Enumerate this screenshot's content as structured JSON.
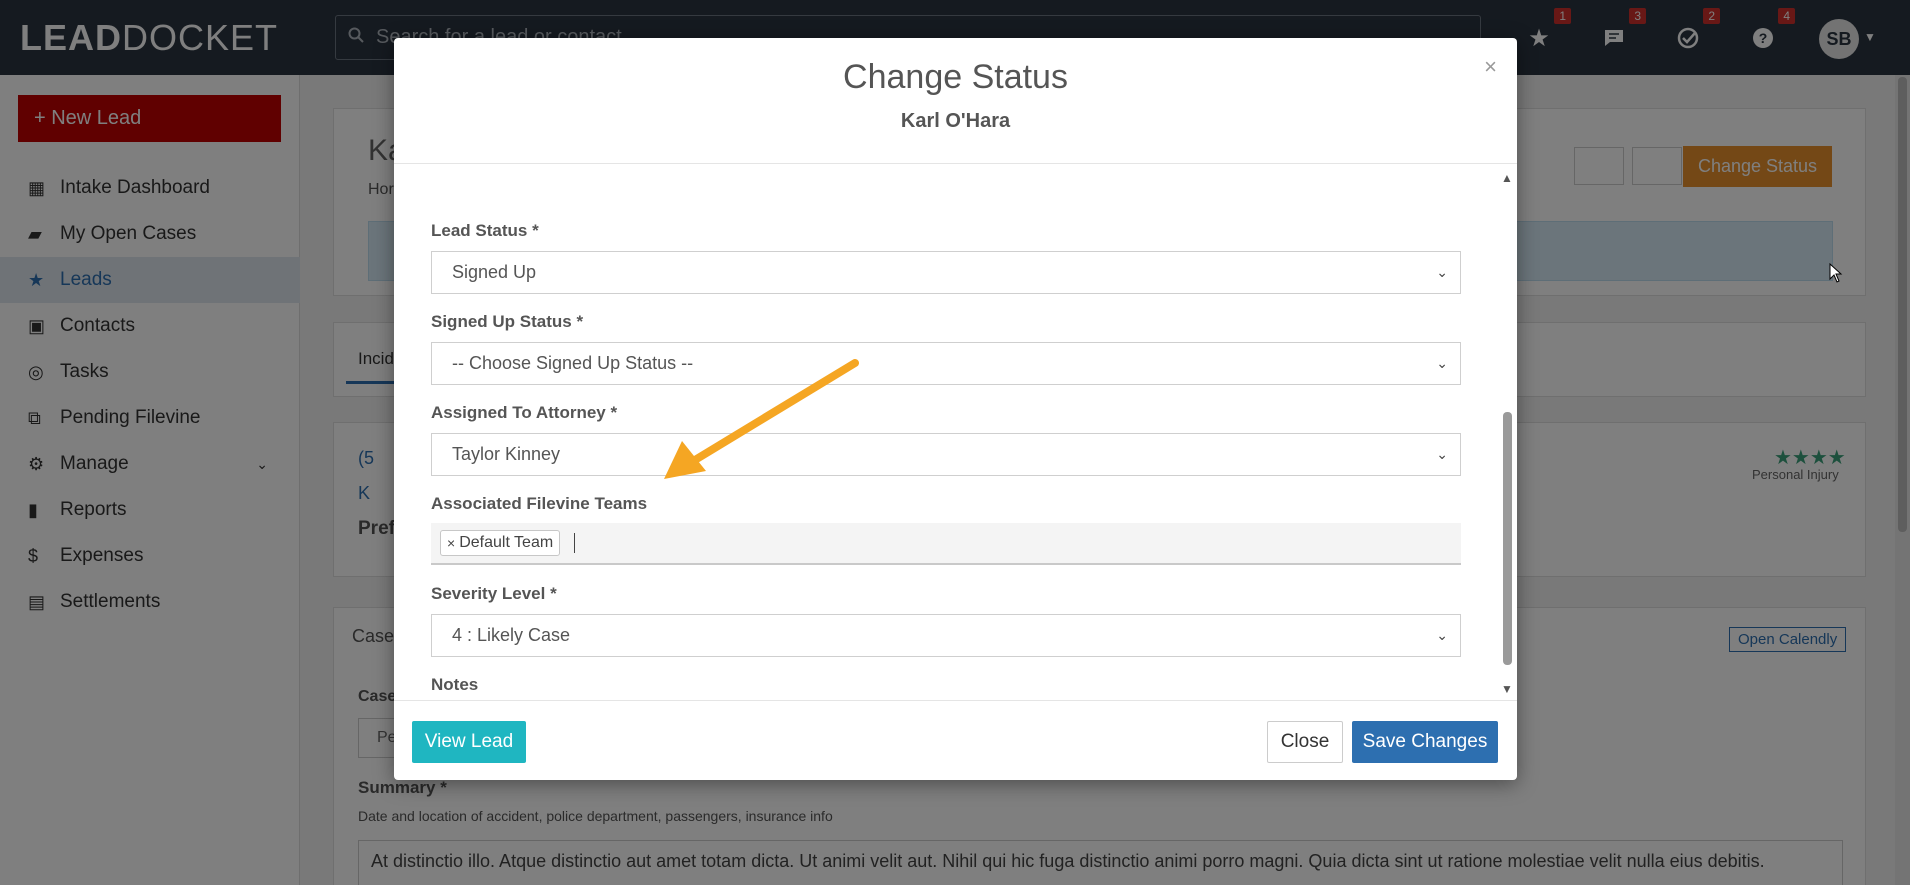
{
  "topbar": {
    "logo_lead": "LEAD",
    "logo_docket": "DOCKET",
    "search_placeholder": "Search for a lead or contact",
    "icons": [
      {
        "name": "star-icon",
        "badge": "1"
      },
      {
        "name": "chat-icon",
        "badge": "3"
      },
      {
        "name": "check-circle-icon",
        "badge": "2"
      },
      {
        "name": "help-icon",
        "badge": "4"
      }
    ],
    "avatar": "SB"
  },
  "sidebar": {
    "new_lead": "+ New Lead",
    "items": [
      {
        "label": "Intake Dashboard",
        "icon": "dashboard-icon"
      },
      {
        "label": "My Open Cases",
        "icon": "briefcase-icon"
      },
      {
        "label": "Leads",
        "icon": "star-icon",
        "active": true
      },
      {
        "label": "Contacts",
        "icon": "contact-card-icon"
      },
      {
        "label": "Tasks",
        "icon": "check-circle-icon"
      },
      {
        "label": "Pending Filevine",
        "icon": "code-icon"
      },
      {
        "label": "Manage",
        "icon": "gear-icon",
        "chevron": true
      },
      {
        "label": "Reports",
        "icon": "bar-chart-icon"
      },
      {
        "label": "Expenses",
        "icon": "dollar-icon"
      },
      {
        "label": "Settlements",
        "icon": "money-icon"
      }
    ]
  },
  "background": {
    "lead_name_partial": "Ka",
    "breadcrumb_partial": "Hor",
    "tab_partial": "Incid",
    "change_status": "Change Status",
    "phone_partial": "(5",
    "email_partial": "K",
    "pref_partial": "Pref",
    "personal_injury": "Personal Injury",
    "case_partial": "Case",
    "case2_partial": "Case",
    "pe_partial": "Pe",
    "open_calendly": "Open Calendly",
    "summary_label": "Summary *",
    "summary_hint": "Date and location of accident, police department, passengers, insurance info",
    "summary_text": "At distinctio illo. Atque distinctio aut amet totam dicta. Ut animi velit aut. Nihil qui hic fuga distinctio animi porro magni. Quia dicta sint ut ratione molestiae velit nulla eius debitis."
  },
  "modal": {
    "title": "Change Status",
    "subtitle": "Karl O'Hara",
    "close": "×",
    "fields": {
      "lead_status_label": "Lead Status *",
      "lead_status_value": "Signed Up",
      "signed_up_status_label": "Signed Up Status *",
      "signed_up_status_value": "-- Choose Signed Up Status --",
      "attorney_label": "Assigned To Attorney *",
      "attorney_value": "Taylor Kinney",
      "teams_label": "Associated Filevine Teams",
      "teams_tag": "Default Team",
      "severity_label": "Severity Level *",
      "severity_value": "4 : Likely Case",
      "notes_label": "Notes"
    },
    "footer": {
      "view_lead": "View Lead",
      "close": "Close",
      "save": "Save Changes"
    }
  },
  "colors": {
    "topbar": "#2b3541",
    "new_lead": "#c00000",
    "active_nav": "#2d6fb0",
    "change_status": "#e8912d",
    "view_lead": "#1fb6c1",
    "save": "#2d6fb0",
    "arrow": "#f5a623"
  }
}
